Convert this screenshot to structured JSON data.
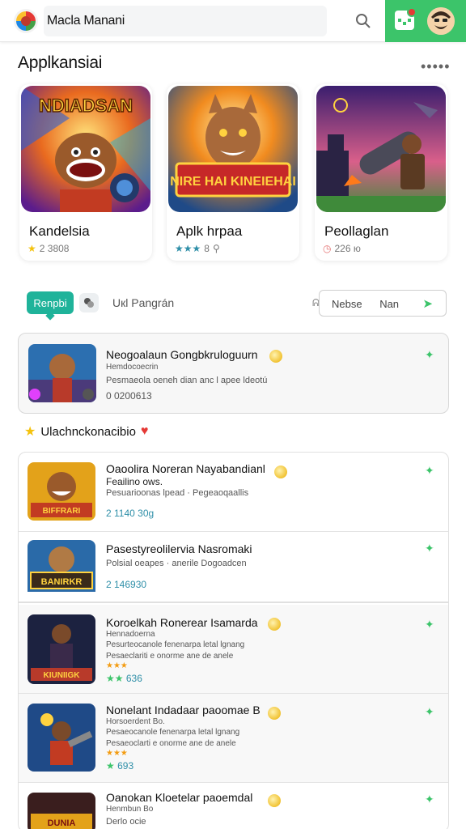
{
  "header": {
    "app_title": "Macla Manani",
    "search_icon": "search-icon",
    "notification_icon": "calendar-icon",
    "profile_icon": "avatar"
  },
  "colors": {
    "accent_green": "#3cc46a",
    "chip_teal": "#1fb39a",
    "meta_blue": "#2f8fa8"
  },
  "section": {
    "title": "Applkansiai",
    "more": "•••••"
  },
  "featured": [
    {
      "name": "Kandelsia",
      "meta": "2 3808",
      "art_text": "NDIADSAN",
      "icon": "star-icon"
    },
    {
      "name": "Aplk hrpaa",
      "meta": "8",
      "art_text": "NIRE HAI KINEIEHAI",
      "icon": "stars-icon"
    },
    {
      "name": "Peollaglan",
      "meta": "226 ю",
      "art_text": "",
      "icon": "clock-icon"
    }
  ],
  "filter": {
    "chip_label": "Renpbi",
    "sort_label": "Uкl Pangrán",
    "toggle": "ᕱ",
    "select_value": "Nebse Nan"
  },
  "highlight": {
    "title": "Neogoalaun Gongbkruloguurn",
    "subtitle": "Hemdocoecrin",
    "desc": "Pesmaeola oeneh dian anc l apee ldeotú",
    "meta": "0 0200613"
  },
  "editors": {
    "title": "Ulachnckonacibio"
  },
  "list": [
    {
      "title": "Oaoolira Noreran Nayabandianl",
      "subtitle": "Feailino ows.",
      "desc": "Pesuarioonas lpead · Pegeaoqaallis",
      "meta": "2 1140 30g",
      "stars": "",
      "art_text": "BIFFRARI"
    },
    {
      "title": "Pasestyreolilervia Nasromaki",
      "subtitle": "",
      "desc": "Polsial oeapes · anerile Dogoadcen",
      "meta": "2 146930",
      "stars": "",
      "art_text": "BANIRKR"
    },
    {
      "title": "Koroelkah Ronerear Isamarda",
      "subtitle": "Hennadoerna",
      "desc": "Pesurteocanole fenenarpa letal lgnang",
      "desc2": "Pesaeclariti e onorme ane de anele",
      "meta": "636",
      "stars": "★★★",
      "art_text": "KIUNIIGK"
    },
    {
      "title": "Nonelant Indadaar paoomae B",
      "subtitle": "Horsoerdent Bo.",
      "desc": "Pesaeocanole fenenarpa letal lgnang",
      "desc2": "Pesaeoclarti e onorme ane de anele",
      "meta": "693",
      "stars": "★★★",
      "art_text": ""
    },
    {
      "title": "Oanokan Kloetelar paoemdal",
      "subtitle": "Henmbun Bo",
      "desc": "Derlo ocie",
      "meta": "",
      "stars": "",
      "art_text": "DUNIA"
    }
  ]
}
